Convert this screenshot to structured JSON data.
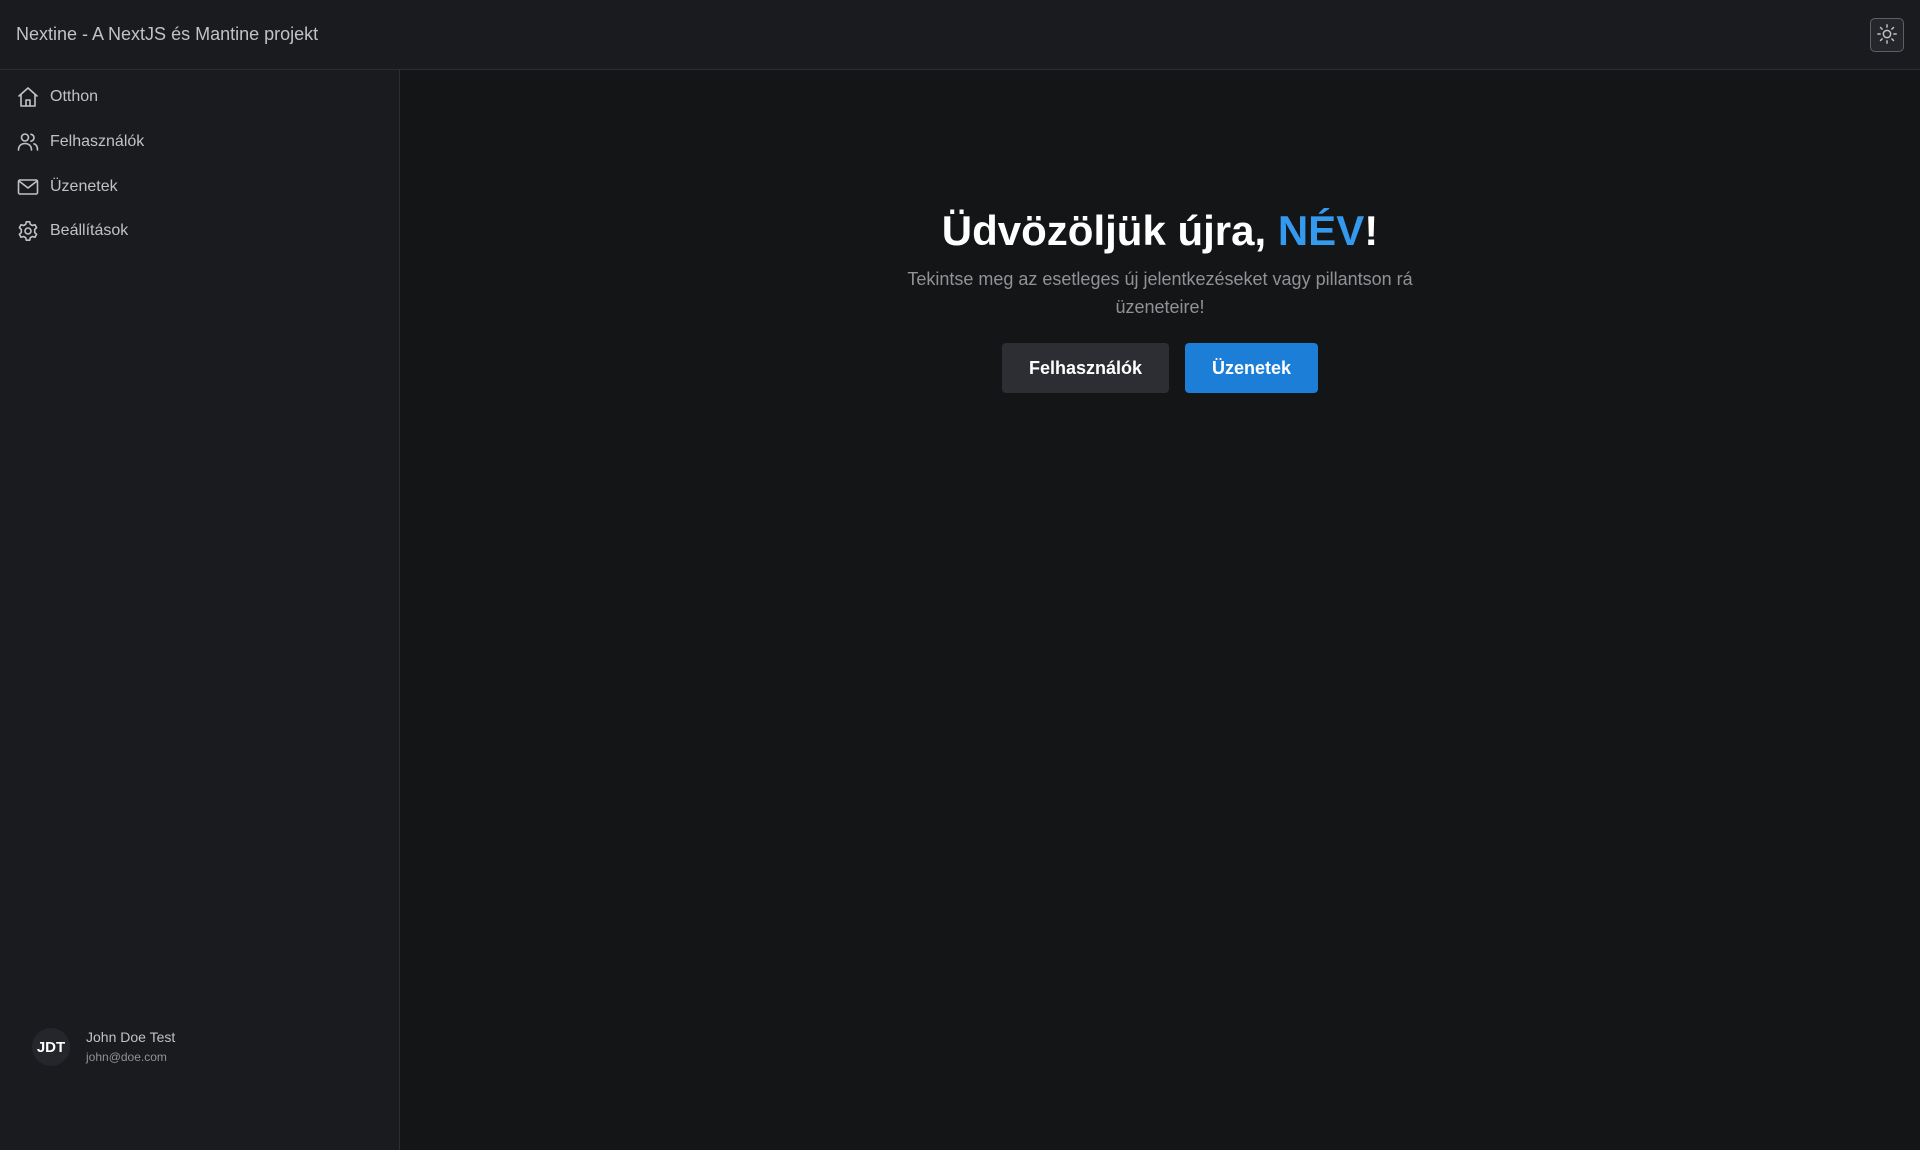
{
  "header": {
    "app_title": "Nextine - A NextJS és Mantine projekt",
    "theme_toggle_icon": "sun-icon"
  },
  "sidebar": {
    "items": [
      {
        "label": "Otthon",
        "icon": "home-icon"
      },
      {
        "label": "Felhasználók",
        "icon": "users-icon"
      },
      {
        "label": "Üzenetek",
        "icon": "mail-icon"
      },
      {
        "label": "Beállítások",
        "icon": "gear-icon"
      }
    ],
    "user": {
      "initials": "JDT",
      "name": "John Doe Test",
      "email": "john@doe.com"
    }
  },
  "main": {
    "title_prefix": "Üdvözöljük újra, ",
    "title_name": "NÉV",
    "title_suffix": "!",
    "subtitle": "Tekintse meg az esetleges új jelentkezéseket vagy pillantson rá üzeneteire!",
    "buttons": {
      "users_label": "Felhasználók",
      "messages_label": "Üzenetek"
    }
  },
  "colors": {
    "accent": "#339af0",
    "primary_button": "#1c7ed6",
    "background": "#141517",
    "panel": "#1a1b1e"
  }
}
